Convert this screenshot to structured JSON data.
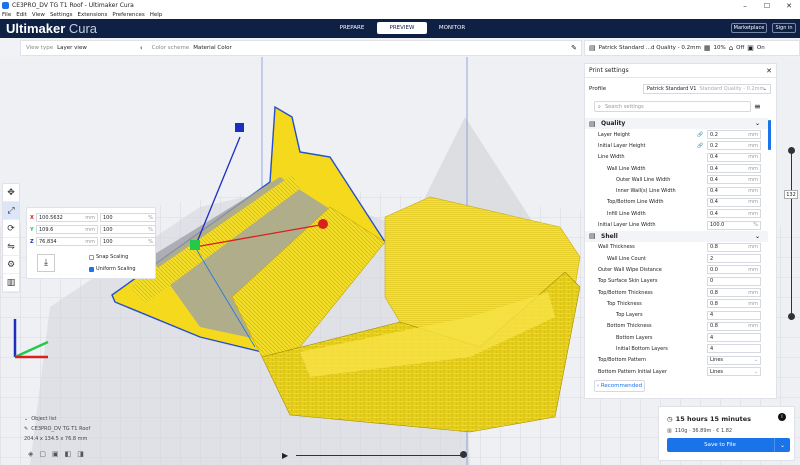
{
  "window": {
    "title": "CE3PRO_DV TG T1 Roof - Ultimaker Cura",
    "controls": [
      "–",
      "☐",
      "✕"
    ]
  },
  "menu": [
    "File",
    "Edit",
    "View",
    "Settings",
    "Extensions",
    "Preferences",
    "Help"
  ],
  "header": {
    "brand_bold": "Ultimaker",
    "brand_light": " Cura",
    "stages": [
      "PREPARE",
      "PREVIEW",
      "MONITOR"
    ],
    "active_stage": "PREVIEW",
    "marketplace": "Marketplace",
    "signin": "Sign in"
  },
  "viewbar": {
    "view_type_label": "View type",
    "view_type_value": "Layer view",
    "color_scheme_label": "Color scheme",
    "color_scheme_value": "Material Color"
  },
  "setupbar": {
    "profile": "Patrick Standard ...d Quality - 0.2mm",
    "infill": "10%",
    "support": "Off",
    "adhesion": "On"
  },
  "scale": {
    "rows": [
      {
        "axis": "X",
        "mm": "100.5632",
        "mm_unit": "mm",
        "pct": "100",
        "pct_unit": "%"
      },
      {
        "axis": "Y",
        "mm": "109.6",
        "mm_unit": "mm",
        "pct": "100",
        "pct_unit": "%"
      },
      {
        "axis": "Z",
        "mm": "76.834",
        "mm_unit": "mm",
        "pct": "100",
        "pct_unit": "%"
      }
    ],
    "snap_scaling": "Snap Scaling",
    "uniform_scaling": "Uniform Scaling"
  },
  "settings": {
    "title": "Print settings",
    "profile_label": "Profile",
    "profile_value": "Patrick Standard V1",
    "profile_faded": "Standard Quality - 0.2mm",
    "search_placeholder": "Search settings",
    "categories": [
      {
        "name": "Quality",
        "rows": [
          {
            "label": "Layer Height",
            "value": "0.2",
            "unit": "mm",
            "indent": 0,
            "link": true
          },
          {
            "label": "Initial Layer Height",
            "value": "0.2",
            "unit": "mm",
            "indent": 0,
            "link": true
          },
          {
            "label": "Line Width",
            "value": "0.4",
            "unit": "mm",
            "indent": 0
          },
          {
            "label": "Wall Line Width",
            "value": "0.4",
            "unit": "mm",
            "indent": 1
          },
          {
            "label": "Outer Wall Line Width",
            "value": "0.4",
            "unit": "mm",
            "indent": 2
          },
          {
            "label": "Inner Wall(s) Line Width",
            "value": "0.4",
            "unit": "mm",
            "indent": 2
          },
          {
            "label": "Top/Bottom Line Width",
            "value": "0.4",
            "unit": "mm",
            "indent": 1
          },
          {
            "label": "Infill Line Width",
            "value": "0.4",
            "unit": "mm",
            "indent": 1
          },
          {
            "label": "Initial Layer Line Width",
            "value": "100.0",
            "unit": "%",
            "indent": 0
          }
        ]
      },
      {
        "name": "Shell",
        "rows": [
          {
            "label": "Wall Thickness",
            "value": "0.8",
            "unit": "mm",
            "indent": 0
          },
          {
            "label": "Wall Line Count",
            "value": "2",
            "unit": "",
            "indent": 1
          },
          {
            "label": "Outer Wall Wipe Distance",
            "value": "0.0",
            "unit": "mm",
            "indent": 0
          },
          {
            "label": "Top Surface Skin Layers",
            "value": "0",
            "unit": "",
            "indent": 0
          },
          {
            "label": "Top/Bottom Thickness",
            "value": "0.8",
            "unit": "mm",
            "indent": 0
          },
          {
            "label": "Top Thickness",
            "value": "0.8",
            "unit": "mm",
            "indent": 1
          },
          {
            "label": "Top Layers",
            "value": "4",
            "unit": "",
            "indent": 2
          },
          {
            "label": "Bottom Thickness",
            "value": "0.8",
            "unit": "mm",
            "indent": 1
          },
          {
            "label": "Bottom Layers",
            "value": "4",
            "unit": "",
            "indent": 2
          },
          {
            "label": "Initial Bottom Layers",
            "value": "4",
            "unit": "",
            "indent": 2
          },
          {
            "label": "Top/Bottom Pattern",
            "value": "Lines",
            "unit": "⌄",
            "indent": 0
          },
          {
            "label": "Bottom Pattern Initial Layer",
            "value": "Lines",
            "unit": "⌄",
            "indent": 0
          }
        ]
      }
    ],
    "recommended": "Recommended"
  },
  "layer": {
    "current": "132",
    "position": 0.74
  },
  "objects": {
    "header": "Object list",
    "name": "CE3PRO_DV TG T1 Roof",
    "dims": "204.4 x 134.5 x 76.8 mm"
  },
  "estimate": {
    "time": "15 hours 15 minutes",
    "material": "110g · 36.89m · € 1.82",
    "save": "Save to File"
  },
  "colors": {
    "header": "#0e2044",
    "accent": "#1a73e8",
    "model": "#f2dc20"
  }
}
